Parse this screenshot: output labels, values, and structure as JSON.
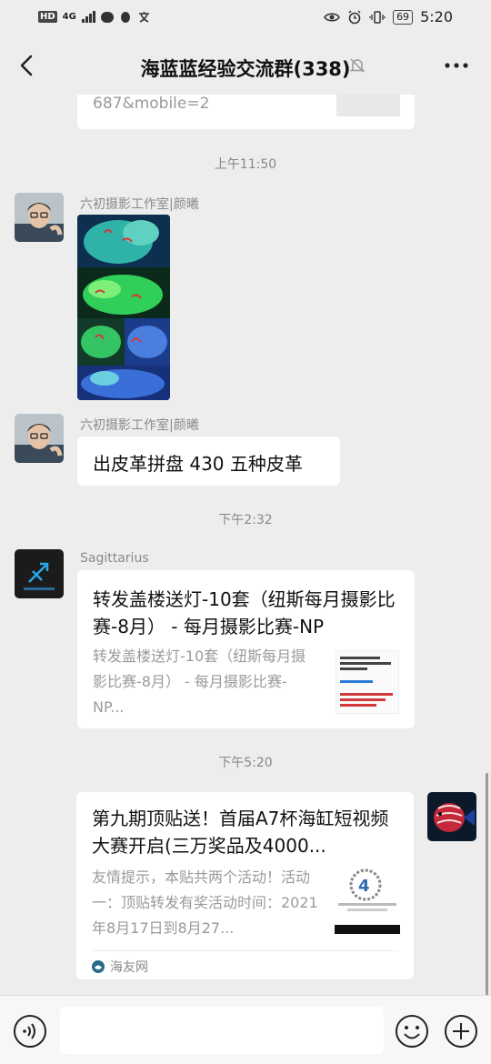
{
  "status_bar": {
    "hd": "HD",
    "network": "4G",
    "battery": "69",
    "time": "5:20"
  },
  "header": {
    "title": "海蓝蓝经验交流群(338)"
  },
  "messages": {
    "partial_link_text": "687&mobile=2",
    "time_1": "上午11:50",
    "sender_1": "六初摄影工作室|颜曦",
    "sender_2": "六初摄影工作室|颜曦",
    "text_2": "出皮革拼盘 430 五种皮革",
    "time_2": "下午2:32",
    "sender_3": "Sagittarius",
    "card_3_title": "转发盖楼送灯-10套（纽斯每月摄影比赛-8月） - 每月摄影比赛-NP",
    "card_3_desc": "转发盖楼送灯-10套（纽斯每月摄影比赛-8月） - 每月摄影比赛-NP...",
    "time_3": "下午5:20",
    "card_4_title": "第九期顶贴送！首届A7杯海缸短视频大赛开启(三万奖品及4000...",
    "card_4_desc": "友情提示，本贴共两个活动！活动一：顶贴转发有奖活动时间：2021年8月17日到8月27...",
    "card_4_source": "海友网"
  },
  "colors": {
    "background": "#ededed",
    "bubble": "#ffffff",
    "secondary_text": "#888888"
  }
}
